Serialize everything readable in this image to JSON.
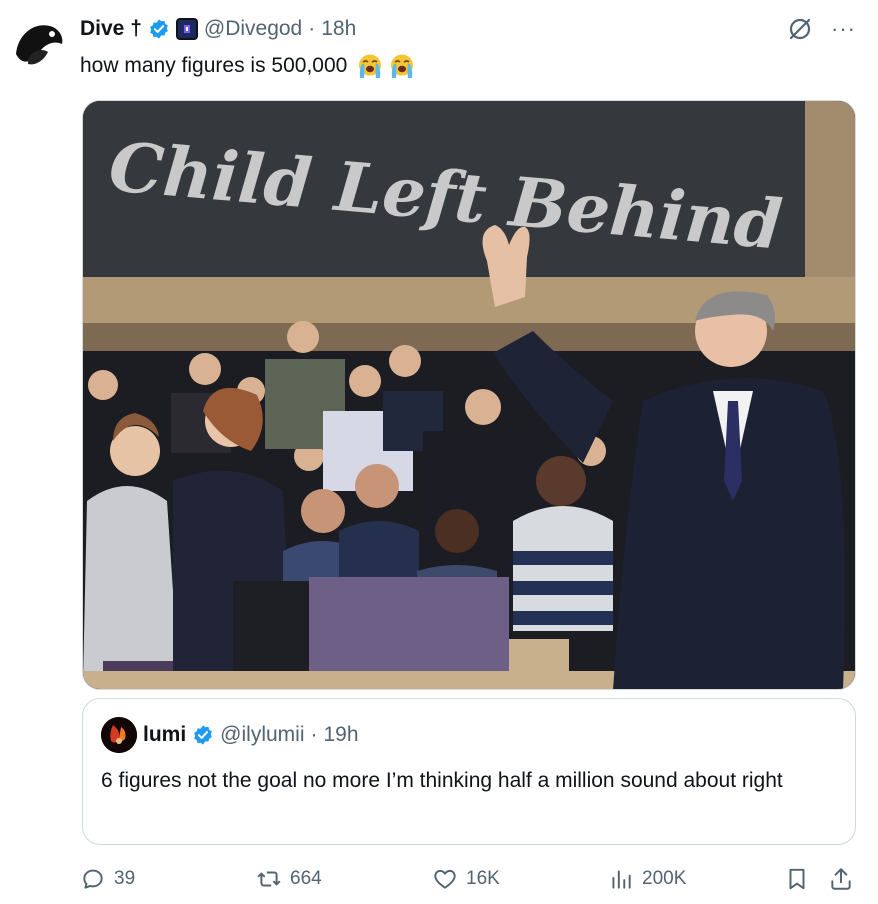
{
  "tweet": {
    "author_name": "Dive †",
    "author_handle": "@Divegod",
    "separator": "·",
    "time": "18h",
    "text": "how many figures is 500,000",
    "emoji": [
      "loudly-crying-face",
      "loudly-crying-face"
    ]
  },
  "media": {
    "chalkboard_text": "Child Left Behind"
  },
  "quote": {
    "author_name": "lumi",
    "author_handle": "@ilylumii",
    "separator": "·",
    "time": "19h",
    "text": "6 figures not the goal no more I’m thinking half a million sound about right"
  },
  "actions": {
    "replies": "39",
    "reposts": "664",
    "likes": "16K",
    "views": "200K"
  },
  "colors": {
    "text": "#0f1419",
    "secondary": "#536471",
    "verified": "#1d9bf0",
    "border": "#cfd9de"
  },
  "icons": [
    "verified-badge-icon",
    "affiliate-icon",
    "grok-icon",
    "more-icon",
    "reply-icon",
    "repost-icon",
    "like-icon",
    "views-icon",
    "bookmark-icon",
    "share-icon"
  ]
}
